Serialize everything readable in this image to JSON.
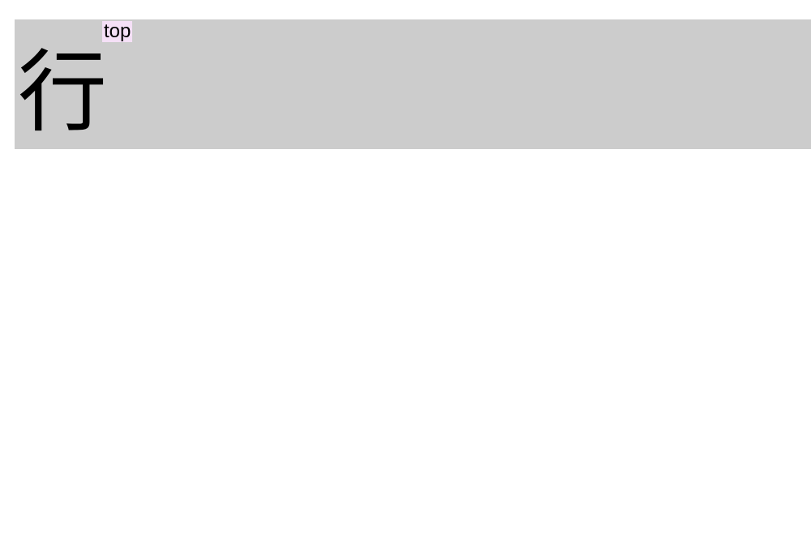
{
  "header": {
    "glyph": "行",
    "label": "top"
  }
}
